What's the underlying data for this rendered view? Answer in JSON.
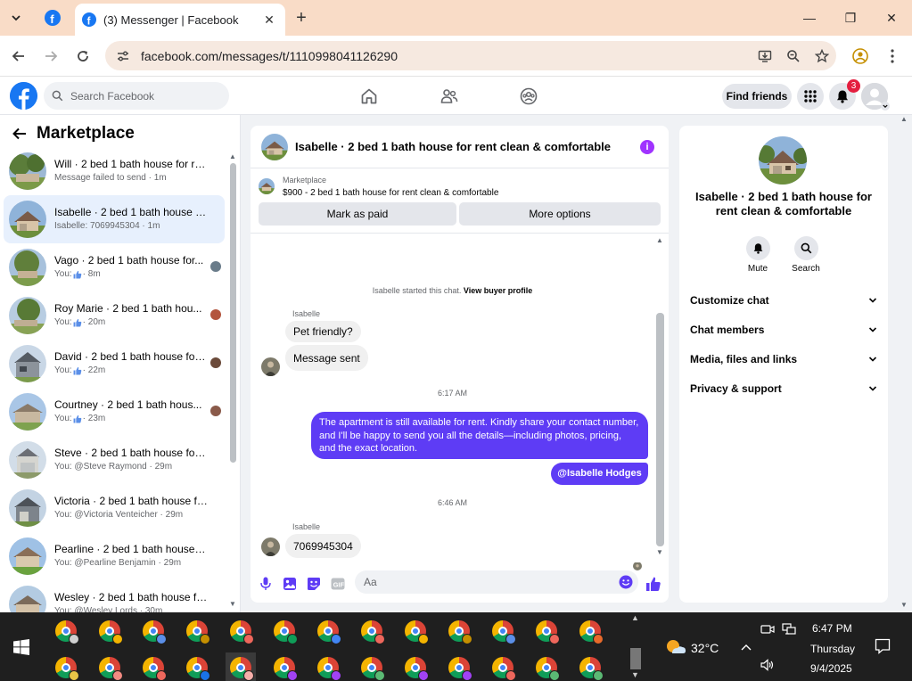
{
  "browser": {
    "tab_title": "(3) Messenger | Facebook",
    "url": "facebook.com/messages/t/1110998041126290"
  },
  "fb": {
    "search_placeholder": "Search Facebook",
    "find_friends": "Find friends",
    "notification_count": "3"
  },
  "sidebar": {
    "title": "Marketplace",
    "conversations": [
      {
        "name": "Will · 2 bed 1 bath house for re...",
        "sub": "Message failed to send · 1m",
        "like": false,
        "active": false
      },
      {
        "name": "Isabelle · 2 bed 1 bath house for...",
        "sub": "Isabelle: 7069945304 · 1m",
        "like": false,
        "active": true
      },
      {
        "name": "Vago · 2 bed 1 bath house for...",
        "sub_prefix": "You:",
        "sub": "· 8m",
        "like": true,
        "active": false
      },
      {
        "name": "Roy Marie · 2 bed 1 bath hou...",
        "sub_prefix": "You:",
        "sub": "· 20m",
        "like": true,
        "active": false
      },
      {
        "name": "David · 2 bed 1 bath house for r...",
        "sub_prefix": "You:",
        "sub": "· 22m",
        "like": true,
        "active": false
      },
      {
        "name": "Courtney · 2 bed 1 bath hous...",
        "sub_prefix": "You:",
        "sub": "· 23m",
        "like": true,
        "active": false
      },
      {
        "name": "Steve · 2 bed 1 bath house for r...",
        "sub": "You: @Steve Raymond · 29m",
        "like": false,
        "active": false
      },
      {
        "name": "Victoria · 2 bed 1 bath house fo...",
        "sub": "You: @Victoria Venteicher · 29m",
        "like": false,
        "active": false
      },
      {
        "name": "Pearline · 2 bed 1 bath house fo...",
        "sub": "You: @Pearline Benjamin · 29m",
        "like": false,
        "active": false
      },
      {
        "name": "Wesley · 2 bed 1 bath house for...",
        "sub": "You: @Wesley Lords · 30m",
        "like": false,
        "active": false
      }
    ]
  },
  "chat": {
    "title": "Isabelle · 2 bed 1 bath house for rent clean & comfortable",
    "listing_label": "Marketplace",
    "listing_price_title": "$900 - 2 bed 1 bath house for rent clean & comfortable",
    "mark_paid": "Mark as paid",
    "more_options": "More options",
    "started_text": "Isabelle started this chat.",
    "view_buyer_profile": "View buyer profile",
    "sender_name": "Isabelle",
    "msg_pet": "Pet friendly?",
    "msg_sent": "Message sent",
    "time_1": "6:17 AM",
    "out_msg": "The apartment is still available for rent. Kindly share your contact number, and I'll be happy to send you all the details—including photos, pricing, and the exact location.",
    "out_mention": "@Isabelle Hodges",
    "time_2": "6:46 AM",
    "msg_phone": "7069945304",
    "composer_placeholder": "Aa"
  },
  "info_panel": {
    "title": "Isabelle · 2 bed 1 bath house for rent clean & comfortable",
    "mute": "Mute",
    "search": "Search",
    "sections": [
      "Customize chat",
      "Chat members",
      "Media, files and links",
      "Privacy & support"
    ]
  },
  "taskbar": {
    "weather": "32°C",
    "time": "6:47 PM",
    "day": "Thursday",
    "date": "9/4/2025",
    "accent": "#1f1f1f"
  },
  "colors": {
    "fb_blue": "#1877f2",
    "bubble_out": "#5e3cf5",
    "info_purple": "#a033ff",
    "tab_bg": "#f9dcc7"
  }
}
